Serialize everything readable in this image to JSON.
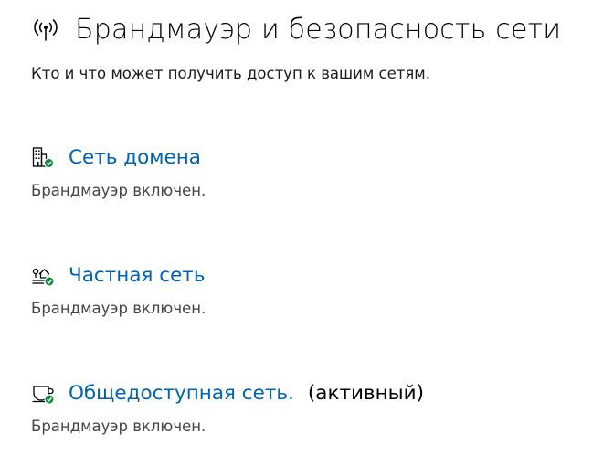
{
  "header": {
    "icon": "antenna-icon",
    "title": "Брандмауэр и безопасность сети"
  },
  "subtitle": "Кто и что может получить доступ к вашим сетям.",
  "colors": {
    "link": "#0063b1",
    "check": "#10893e"
  },
  "networks": [
    {
      "icon": "domain-network-icon",
      "name": "Сеть домена",
      "active_label": "",
      "status": "Брандмауэр включен."
    },
    {
      "icon": "private-network-icon",
      "name": "Частная сеть",
      "active_label": "",
      "status": "Брандмауэр включен."
    },
    {
      "icon": "public-network-icon",
      "name": "Общедоступная сеть.",
      "active_label": "(активный)",
      "status": "Брандмауэр включен."
    }
  ]
}
